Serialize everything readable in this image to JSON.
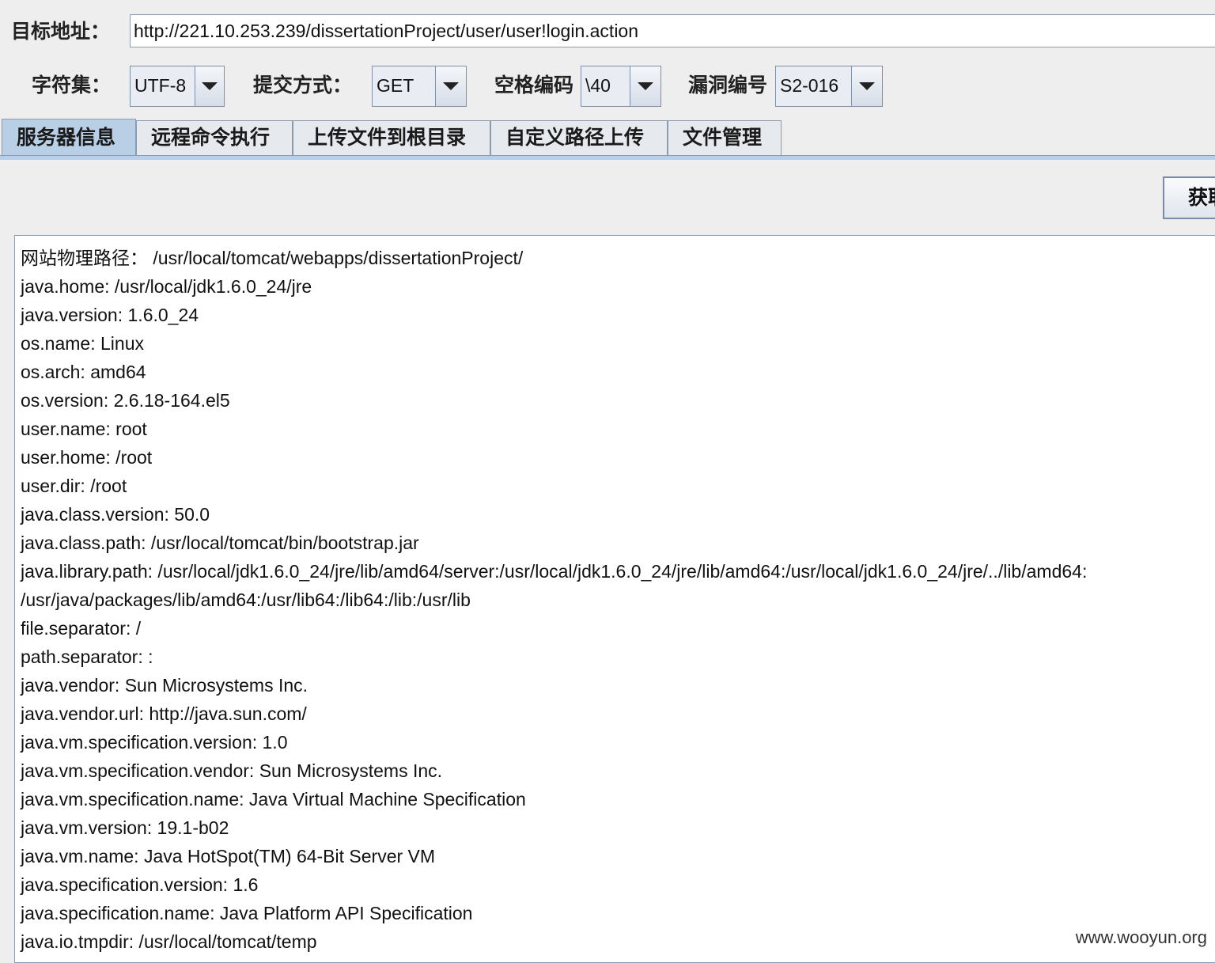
{
  "target": {
    "label": "目标地址：",
    "url": "http://221.10.253.239/dissertationProject/user/user!login.action"
  },
  "options": {
    "charset": {
      "label": "字符集：",
      "value": "UTF-8"
    },
    "method": {
      "label": "提交方式：",
      "value": "GET"
    },
    "space_encoding": {
      "label": "空格编码",
      "value": "\\40"
    },
    "vuln_id": {
      "label": "漏洞编号",
      "value": "S2-016"
    }
  },
  "tabs": [
    {
      "label": "服务器信息",
      "active": true
    },
    {
      "label": "远程命令执行",
      "active": false
    },
    {
      "label": "上传文件到根目录",
      "active": false
    },
    {
      "label": "自定义路径上传",
      "active": false
    },
    {
      "label": "文件管理",
      "active": false
    }
  ],
  "fetch_button": {
    "label": "获取"
  },
  "output_lines": [
    "网站物理路径： /usr/local/tomcat/webapps/dissertationProject/",
    "java.home: /usr/local/jdk1.6.0_24/jre",
    "java.version: 1.6.0_24",
    "os.name: Linux",
    "os.arch: amd64",
    "os.version: 2.6.18-164.el5",
    "user.name: root",
    "user.home: /root",
    "user.dir: /root",
    "java.class.version: 50.0",
    "java.class.path: /usr/local/tomcat/bin/bootstrap.jar",
    "java.library.path: /usr/local/jdk1.6.0_24/jre/lib/amd64/server:/usr/local/jdk1.6.0_24/jre/lib/amd64:/usr/local/jdk1.6.0_24/jre/../lib/amd64:",
    "/usr/java/packages/lib/amd64:/usr/lib64:/lib64:/lib:/usr/lib",
    "file.separator: /",
    "path.separator: :",
    "java.vendor: Sun Microsystems Inc.",
    "java.vendor.url: http://java.sun.com/",
    "java.vm.specification.version: 1.0",
    "java.vm.specification.vendor: Sun Microsystems Inc.",
    "java.vm.specification.name: Java Virtual Machine Specification",
    "java.vm.version: 19.1-b02",
    "java.vm.name: Java HotSpot(TM) 64-Bit Server VM",
    "java.specification.version: 1.6",
    "java.specification.name: Java Platform API Specification",
    "java.io.tmpdir: /usr/local/tomcat/temp"
  ],
  "watermark": "www.wooyun.org"
}
